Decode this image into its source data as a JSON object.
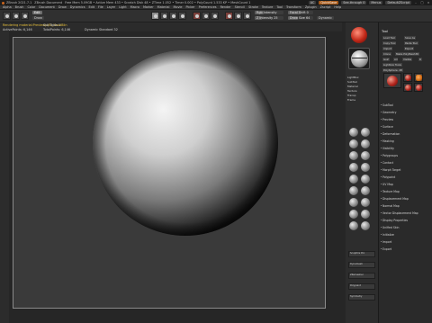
{
  "titlebar": {
    "app": "ZBrush 2021.7.1",
    "project": "ZBrush Document",
    "mem": "Free Mem 5.09GB • Active Mem 433 • Scratch Disk 48 • ZTime 1.052 • Timer 0.002 • PolyCount 1.533 KP • MeshCount 1",
    "buttons": [
      "AC",
      "QuickSave",
      "See-through 0",
      "Menus",
      "DefaultZScript"
    ]
  },
  "menu": [
    "Alpha",
    "Brush",
    "Color",
    "Document",
    "Draw",
    "Dynamics",
    "Edit",
    "File",
    "Layer",
    "Light",
    "Macro",
    "Marker",
    "Material",
    "Movie",
    "Picker",
    "Preferences",
    "Render",
    "Stencil",
    "Stroke",
    "Texture",
    "Tool",
    "Transform",
    "Zplugin",
    "Zscript",
    "Help"
  ],
  "shelf": {
    "switch_color": "Switch Color",
    "gradient": "Gradient",
    "layer": "Layer",
    "edit": "Edit",
    "draw": "Draw",
    "move": "Move",
    "scale": "Scale",
    "rotate": "Rotate",
    "projection": "Projection Master",
    "lightbox": "LightBox",
    "live_boolean": "Live Boolean",
    "mrgb": "Mrgb",
    "rgb": "Rgb",
    "m": "M",
    "zadd": "Zadd",
    "zsub": "Zsub",
    "zcut": "Zcut",
    "rgb_intensity": "Rgb Intensity",
    "focal_shift": "Focal Shift 0",
    "draw_size": "Draw Size 64",
    "dynamic": "Dynamic",
    "active_points": "ActivePoints: 6,146",
    "total_points": "TotalPoints: 6,146",
    "sub_tools": "Sub Tools 1",
    "z_intensity": "Z Intensity 25"
  },
  "info": {
    "line1": "Rendering material:Preview(s)BI_NoodBlin",
    "line2": "ActivePoints: 6,146",
    "line3": "TotalPoints: 6,146",
    "xpose": "Sub Tools 1",
    "front": "Front Sub 1",
    "persp": "Dynamic Standard 32"
  },
  "rightbar": {
    "items": [
      "Lazymouse",
      "Backface",
      "Subdiv",
      "Perspective",
      "Floor",
      "Local",
      "Lsym",
      "Xpose"
    ],
    "labels": [
      "LightBox",
      "SubTool",
      "Material",
      "Texture",
      "Transp",
      "Frame",
      "Move",
      "Scale",
      "Rotate"
    ],
    "brushes": [
      "Move",
      "ClayBuildup",
      "Standard",
      "DamStandard",
      "Inflat",
      "Pinch",
      "Smooth",
      "TrimDynamic",
      "hPolish",
      "Flatten",
      "Slash3",
      "Snakehook",
      "Topology",
      "IMM Primitives",
      "ZModeler",
      "SelectRect"
    ],
    "buttons": [
      "Sculptris Pro",
      "Dynamesh",
      "ZRemesher",
      "Polypaint",
      "Symmetry",
      "Restore"
    ]
  },
  "palette": {
    "title": "Tool",
    "load": "Load Tool",
    "save": "Save As",
    "copy": "Copy Tool",
    "paste": "Paste Tool",
    "import": "Import",
    "export": "Export",
    "clone": "Clone",
    "make": "Make PolyMesh3D",
    "goz": "GoZ",
    "all": "All",
    "visible": "Visible",
    "r": "R",
    "lightbox": "Lightbox Tools",
    "current": "PolySphere. 48",
    "thumbs": [
      "PolySphere",
      "SimpleBrush",
      "PolySphere",
      "PolySphere"
    ],
    "sections": [
      "SubTool",
      "Geometry",
      "Preview",
      "Surface",
      "Deformation",
      "Masking",
      "Visibility",
      "Polygroups",
      "Contact",
      "Morph Target",
      "Polypaint",
      "UV Map",
      "Texture Map",
      "Displacement Map",
      "Normal Map",
      "Vector Displacement Map",
      "Display Properties",
      "Unified Skin",
      "Initialize",
      "Import",
      "Export"
    ]
  }
}
